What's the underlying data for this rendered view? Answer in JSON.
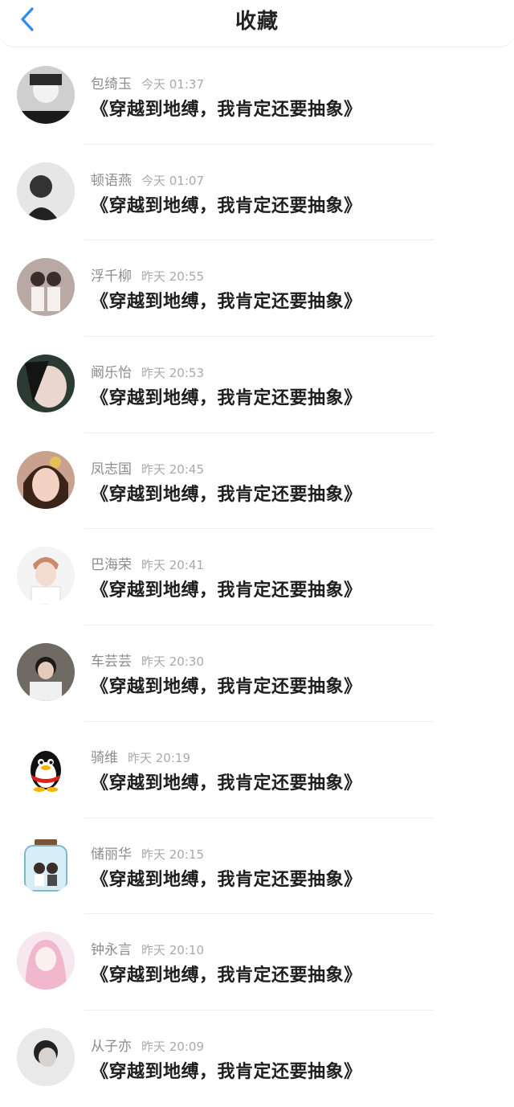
{
  "header": {
    "title": "收藏"
  },
  "favorites": [
    {
      "name": "包绮玉",
      "time": "今天 01:37",
      "text": "《穿越到地缚，我肯定还要抽象》",
      "avatar": "avatar-photo-icon"
    },
    {
      "name": "顿语燕",
      "time": "今天 01:07",
      "text": "《穿越到地缚，我肯定还要抽象》",
      "avatar": "avatar-photo-icon"
    },
    {
      "name": "浮千柳",
      "time": "昨天 20:55",
      "text": "《穿越到地缚，我肯定还要抽象》",
      "avatar": "avatar-photo-icon"
    },
    {
      "name": "阚乐怡",
      "time": "昨天 20:53",
      "text": "《穿越到地缚，我肯定还要抽象》",
      "avatar": "avatar-photo-icon"
    },
    {
      "name": "凤志国",
      "time": "昨天 20:45",
      "text": "《穿越到地缚，我肯定还要抽象》",
      "avatar": "avatar-photo-icon"
    },
    {
      "name": "巴海荣",
      "time": "昨天 20:41",
      "text": "《穿越到地缚，我肯定还要抽象》",
      "avatar": "avatar-photo-icon"
    },
    {
      "name": "车芸芸",
      "time": "昨天 20:30",
      "text": "《穿越到地缚，我肯定还要抽象》",
      "avatar": "avatar-photo-icon"
    },
    {
      "name": "骑维",
      "time": "昨天 20:19",
      "text": "《穿越到地缚，我肯定还要抽象》",
      "avatar": "penguin-icon"
    },
    {
      "name": "储丽华",
      "time": "昨天 20:15",
      "text": "《穿越到地缚，我肯定还要抽象》",
      "avatar": "bottle-icon"
    },
    {
      "name": "钟永言",
      "time": "昨天 20:10",
      "text": "《穿越到地缚，我肯定还要抽象》",
      "avatar": "avatar-photo-icon"
    },
    {
      "name": "从子亦",
      "time": "昨天 20:09",
      "text": "《穿越到地缚，我肯定还要抽象》",
      "avatar": "avatar-photo-icon"
    }
  ],
  "colors": {
    "accent": "#2f8cf0",
    "name": "#8c8c8c",
    "time": "#aaaaaa",
    "text": "#1e1e1e"
  }
}
